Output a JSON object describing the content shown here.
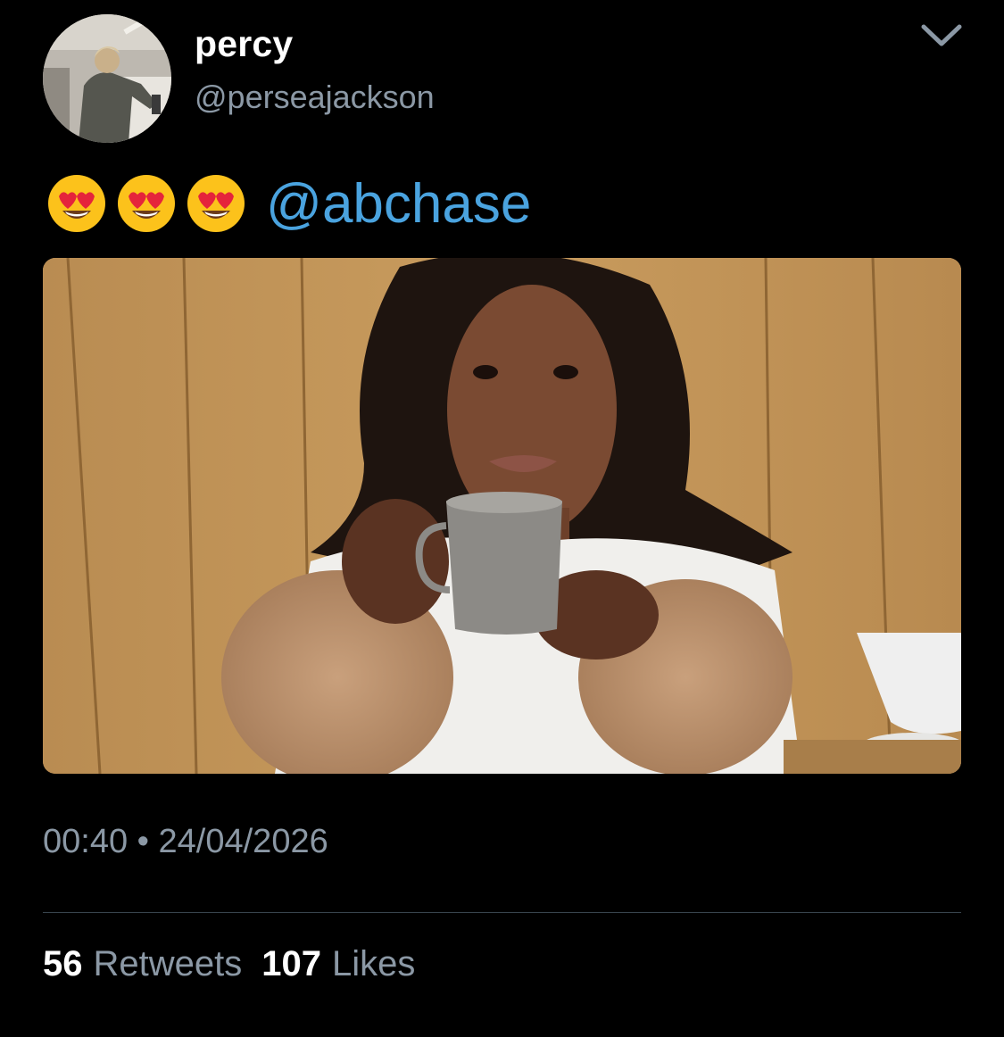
{
  "tweet": {
    "display_name": "percy",
    "handle": "@perseajackson",
    "emojis": [
      "😍",
      "😍",
      "😍"
    ],
    "mention": "@abchase",
    "time": "00:40",
    "separator": "•",
    "date": "24/04/2026",
    "retweets_count": "56",
    "retweets_label": "Retweets",
    "likes_count": "107",
    "likes_label": "Likes"
  },
  "icons": {
    "menu": "chevron-down-icon",
    "emoji": "heart-eyes-emoji"
  },
  "colors": {
    "background": "#000000",
    "text_primary": "#ffffff",
    "text_secondary": "#8b98a5",
    "mention": "#4aa3df",
    "divider": "#38444d"
  }
}
